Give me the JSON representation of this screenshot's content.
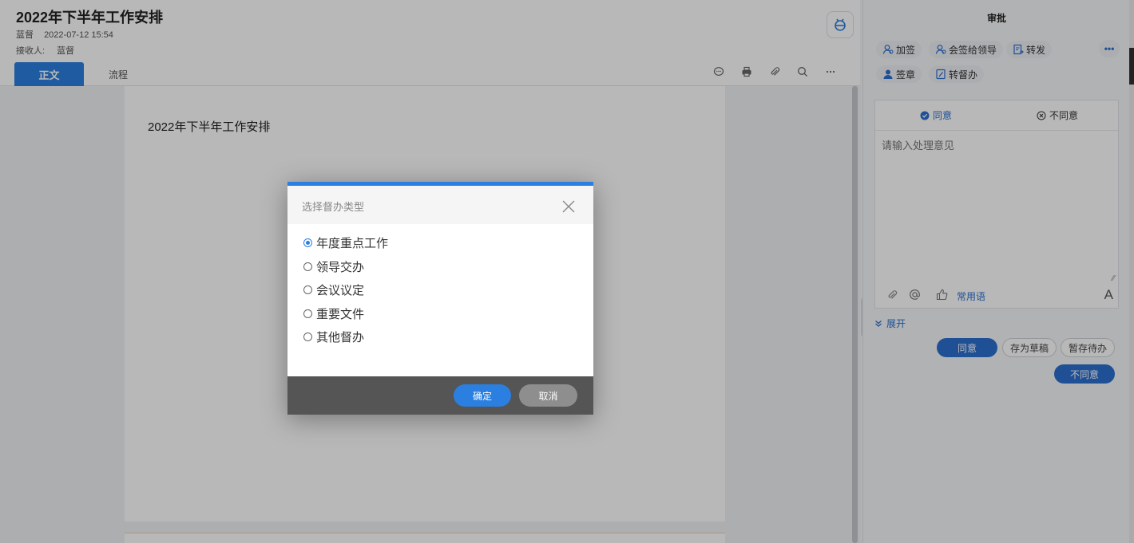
{
  "document": {
    "title": "2022年下半年工作安排",
    "author": "蓝督",
    "datetime": "2022-07-12 15:54",
    "recipient_label": "接收人:",
    "recipient": "蓝督",
    "tabs": [
      {
        "label": "正文",
        "active": true
      },
      {
        "label": "流程",
        "active": false
      }
    ],
    "page_title": "2022年下半年工作安排"
  },
  "panel": {
    "title": "审批",
    "actions_row1": [
      "加签",
      "会签给领导",
      "转发"
    ],
    "actions_row2": [
      "签章",
      "转督办"
    ],
    "opinion_tabs": {
      "agree": "同意",
      "disagree": "不同意"
    },
    "opinion_placeholder": "请输入处理意见",
    "common_phrases": "常用语",
    "font_icon_text": "A",
    "expand_label": "展开",
    "buttons": {
      "agree": "同意",
      "save_draft": "存为草稿",
      "hold": "暂存待办",
      "disagree": "不同意"
    }
  },
  "modal": {
    "title": "选择督办类型",
    "options": [
      {
        "label": "年度重点工作",
        "checked": true
      },
      {
        "label": "领导交办",
        "checked": false
      },
      {
        "label": "会议议定",
        "checked": false
      },
      {
        "label": "重要文件",
        "checked": false
      },
      {
        "label": "其他督办",
        "checked": false
      }
    ],
    "confirm": "确定",
    "cancel": "取消"
  },
  "colors": {
    "accent": "#2b7fe0",
    "panel_accent": "#2b6fd0",
    "modal_footer": "#555555"
  }
}
